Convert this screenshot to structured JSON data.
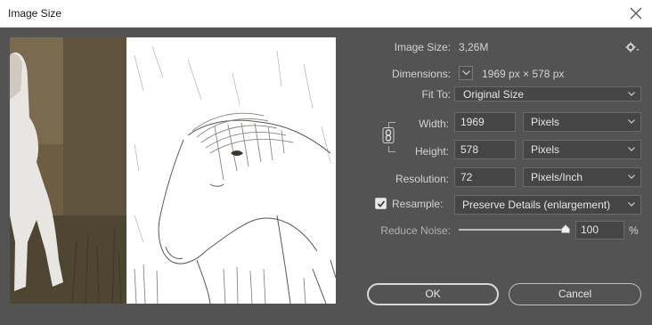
{
  "window": {
    "title": "Image Size"
  },
  "info": {
    "image_size_label": "Image Size:",
    "image_size_value": "3,26M",
    "dimensions_label": "Dimensions:",
    "dimensions_value": "1969 px  ×  578 px",
    "fit_to_label": "Fit To:",
    "fit_to_value": "Original Size"
  },
  "size": {
    "width_label": "Width:",
    "width_value": "1969",
    "width_unit": "Pixels",
    "height_label": "Height:",
    "height_value": "578",
    "height_unit": "Pixels",
    "resolution_label": "Resolution:",
    "resolution_value": "72",
    "resolution_unit": "Pixels/Inch"
  },
  "resample": {
    "label": "Resample:",
    "checked": true,
    "method": "Preserve Details (enlargement)"
  },
  "noise": {
    "label": "Reduce Noise:",
    "value": "100",
    "unit": "%",
    "level_fraction": 1.0
  },
  "buttons": {
    "ok": "OK",
    "cancel": "Cancel"
  },
  "icons": {
    "close": "close-icon",
    "gear": "gear-icon",
    "link": "link-icon",
    "check": "checkmark-icon",
    "chevron": "chevron-down-icon"
  }
}
